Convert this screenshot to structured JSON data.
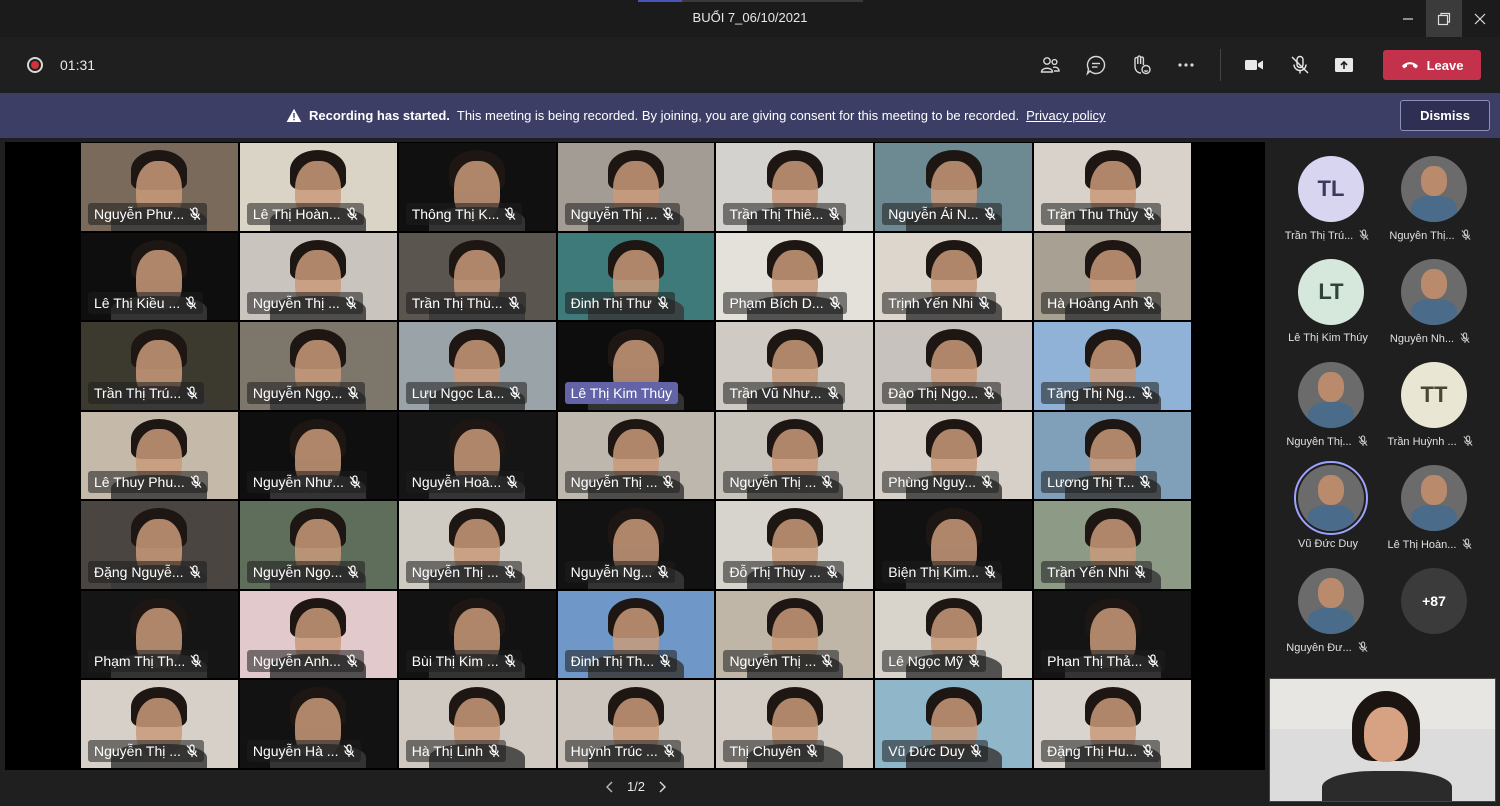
{
  "window": {
    "title": "BUỔI 7_06/10/2021"
  },
  "toolbar": {
    "timer": "01:31",
    "leave_label": "Leave"
  },
  "banner": {
    "bold": "Recording has started.",
    "text": "This meeting is being recorded. By joining, you are giving consent for this meeting to be recorded.",
    "link": "Privacy policy",
    "dismiss_label": "Dismiss"
  },
  "grid": {
    "tiles": [
      {
        "name": "Nguyễn Phư...",
        "bg": "#7a6a5c"
      },
      {
        "name": "Lê Thị Hoàn...",
        "bg": "#d9d4c6"
      },
      {
        "name": "Thông Thị K...",
        "bg": "#101010"
      },
      {
        "name": "Nguyễn Thị ...",
        "bg": "#a39c94"
      },
      {
        "name": "Trần Thị Thiê...",
        "bg": "#d4d2cf"
      },
      {
        "name": "Nguyễn Ái N...",
        "bg": "#6d8a93"
      },
      {
        "name": "Trần Thu Thủy",
        "bg": "#d8d2cb"
      },
      {
        "name": "Lê Thị Kiều ...",
        "bg": "#0e0e0e"
      },
      {
        "name": "Nguyễn Thị ...",
        "bg": "#c9c4bd"
      },
      {
        "name": "Trần Thị Thù...",
        "bg": "#5b5550"
      },
      {
        "name": "Đinh Thị Thư",
        "bg": "#3f7a7a"
      },
      {
        "name": "Phạm Bích D...",
        "bg": "#e4e0da"
      },
      {
        "name": "Trịnh Yến Nhi",
        "bg": "#ddd6cc"
      },
      {
        "name": "Hà Hoàng Anh",
        "bg": "#a7a093"
      },
      {
        "name": "Trần Thị Trú...",
        "bg": "#3c3a2e"
      },
      {
        "name": "Nguyễn Ngọ...",
        "bg": "#7c766b"
      },
      {
        "name": "Lưu Ngọc La...",
        "bg": "#9aa3a7"
      },
      {
        "name": "Lê Thị Kim Thúy",
        "bg": "#0d0d0d",
        "active": true
      },
      {
        "name": "Trần Vũ Như...",
        "bg": "#cfcac3"
      },
      {
        "name": "Đào Thị Ngọ...",
        "bg": "#c7c2bd"
      },
      {
        "name": "Tăng Thị Ng...",
        "bg": "#8fb2d6"
      },
      {
        "name": "Lê Thuy Phu...",
        "bg": "#c5b9aa"
      },
      {
        "name": "Nguyễn Như...",
        "bg": "#0f0f0f"
      },
      {
        "name": "Nguyễn Hoà...",
        "bg": "#151515"
      },
      {
        "name": "Nguyễn Thị ...",
        "bg": "#bdb7ae"
      },
      {
        "name": "Nguyễn Thị ...",
        "bg": "#c8c3bb"
      },
      {
        "name": "Phùng Nguy...",
        "bg": "#d6d0c9"
      },
      {
        "name": "Lương Thị T...",
        "bg": "#7fa0b8"
      },
      {
        "name": "Đặng Nguyễ...",
        "bg": "#4a4540"
      },
      {
        "name": "Nguyễn Ngọ...",
        "bg": "#5f6e5b"
      },
      {
        "name": "Nguyễn Thị ...",
        "bg": "#cfcac2"
      },
      {
        "name": "Nguyễn Ng...",
        "bg": "#121212"
      },
      {
        "name": "Đỗ Thị Thùy ...",
        "bg": "#d7d3cd"
      },
      {
        "name": "Biện Thị Kim...",
        "bg": "#111111"
      },
      {
        "name": "Trần Yến Nhi",
        "bg": "#8d9a86"
      },
      {
        "name": "Phạm Thị Th...",
        "bg": "#151515"
      },
      {
        "name": "Nguyễn Anh...",
        "bg": "#e2c9cc"
      },
      {
        "name": "Bùi Thị Kim ...",
        "bg": "#121212"
      },
      {
        "name": "Đinh Thị Th...",
        "bg": "#6f97c8"
      },
      {
        "name": "Nguyễn Thị ...",
        "bg": "#bfb6a8"
      },
      {
        "name": "Lê Ngọc Mỹ",
        "bg": "#d8d3cb"
      },
      {
        "name": "Phan Thị Thả...",
        "bg": "#141414"
      },
      {
        "name": "Nguyễn Thị ...",
        "bg": "#d6d0c8"
      },
      {
        "name": "Nguyễn Hà ...",
        "bg": "#121212"
      },
      {
        "name": "Hà Thị Linh",
        "bg": "#cfc9c1"
      },
      {
        "name": "Huỳnh Trúc ...",
        "bg": "#cbc5bd"
      },
      {
        "name": "Thị Chuyên",
        "bg": "#d2ccc5"
      },
      {
        "name": "Vũ Đức Duy",
        "bg": "#8fb6c9"
      },
      {
        "name": "Đặng Thị Hu...",
        "bg": "#d9d4cd"
      }
    ],
    "pager": "1/2"
  },
  "side": {
    "participants": [
      {
        "name": "Trần Thị Trú...",
        "initials": "TL",
        "kind": "initials-a",
        "muted": true
      },
      {
        "name": "Nguyễn Thị...",
        "initials": "",
        "kind": "photo",
        "muted": true
      },
      {
        "name": "Lê Thị Kim Thúy",
        "initials": "LT",
        "kind": "initials-b",
        "muted": false
      },
      {
        "name": "Nguyễn Nh...",
        "initials": "",
        "kind": "photo",
        "muted": true
      },
      {
        "name": "Nguyễn Thị...",
        "initials": "",
        "kind": "photo",
        "muted": true
      },
      {
        "name": "Trần Huỳnh ...",
        "initials": "TT",
        "kind": "initials-c",
        "muted": true
      },
      {
        "name": "Vũ Đức Duy",
        "initials": "",
        "kind": "photo",
        "muted": false,
        "speaking": true
      },
      {
        "name": "Lê Thị Hoàn...",
        "initials": "",
        "kind": "photo",
        "muted": true
      },
      {
        "name": "Nguyễn Đư...",
        "initials": "",
        "kind": "photo",
        "muted": true
      },
      {
        "name": "",
        "initials": "+87",
        "kind": "more",
        "muted": false
      }
    ]
  },
  "colors": {
    "leave": "#c4314b",
    "banner": "#3d3e66",
    "active_nameplate": "#6264a7"
  }
}
